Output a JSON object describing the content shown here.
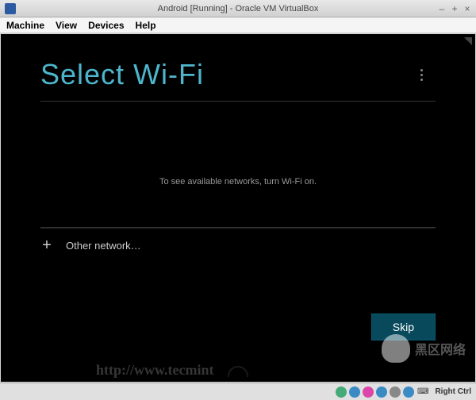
{
  "window": {
    "title": "Android [Running] - Oracle VM VirtualBox",
    "controls": {
      "min": "‒",
      "max": "+",
      "close": "×"
    }
  },
  "menubar": {
    "machine": "Machine",
    "view": "View",
    "devices": "Devices",
    "help": "Help"
  },
  "android": {
    "title": "Select Wi-Fi",
    "empty_message": "To see available networks, turn Wi-Fi on.",
    "other_network": "Other network…",
    "skip": "Skip"
  },
  "statusbar": {
    "host_key": "Right Ctrl"
  },
  "watermark": {
    "text": "黑区网络",
    "url": "http://www.tecmint"
  }
}
